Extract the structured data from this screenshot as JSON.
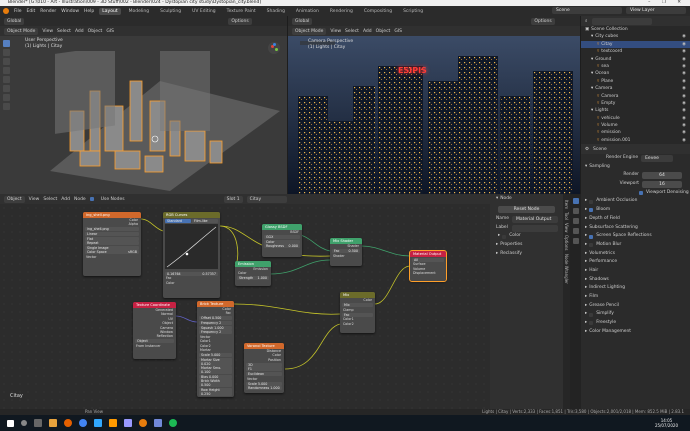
{
  "window": {
    "title": "Blender* [G:\\010 - Art - Illustration\\009 - 3D Stuff\\002 - Blender\\024 - Dystopian city study\\Dystopian_city.blend]",
    "controls": [
      "–",
      "❐",
      "✕"
    ]
  },
  "menu": {
    "items": [
      "File",
      "Edit",
      "Render",
      "Window",
      "Help"
    ],
    "workspaces": [
      "Layout",
      "Modeling",
      "Sculpting",
      "UV Editing",
      "Texture Paint",
      "Shading",
      "Animation",
      "Rendering",
      "Compositing",
      "Scripting"
    ],
    "active_workspace": "Layout",
    "scene_label": "Scene",
    "view_layer_label": "View Layer"
  },
  "viewport_left": {
    "header": {
      "mode": "Object Mode",
      "view": "View",
      "select": "Select",
      "add": "Add",
      "object": "Object",
      "gis": "GIS",
      "orientation": "Global",
      "options": "Options"
    },
    "perspective": "User Perspective",
    "collection": "(1) Lights | Citay"
  },
  "viewport_right": {
    "header": {
      "mode": "Object Mode",
      "view": "View",
      "select": "Select",
      "add": "Add",
      "object": "Object",
      "gis": "GIS",
      "orientation": "Global",
      "options": "Options"
    },
    "perspective": "Camera Perspective",
    "collection": "(1) Lights | Citay",
    "sign_text": "ESIPIS"
  },
  "outliner": {
    "title": "Scene Collection",
    "rows": [
      {
        "label": "City cubes",
        "indent": 1,
        "selected": false
      },
      {
        "label": "Citay",
        "indent": 2,
        "selected": true
      },
      {
        "label": "textcoord",
        "indent": 2,
        "selected": false
      },
      {
        "label": "Ground",
        "indent": 1,
        "selected": false
      },
      {
        "label": "sea",
        "indent": 2,
        "selected": false
      },
      {
        "label": "Ocean",
        "indent": 1,
        "selected": false
      },
      {
        "label": "Plane",
        "indent": 2,
        "selected": false
      },
      {
        "label": "Camera",
        "indent": 1,
        "selected": false
      },
      {
        "label": "Camera",
        "indent": 2,
        "selected": false
      },
      {
        "label": "Empty",
        "indent": 2,
        "selected": false
      },
      {
        "label": "Lights",
        "indent": 1,
        "selected": false
      },
      {
        "label": "vehicule",
        "indent": 2,
        "selected": false
      },
      {
        "label": "Volume",
        "indent": 2,
        "selected": false
      },
      {
        "label": "emission",
        "indent": 2,
        "selected": false
      },
      {
        "label": "emission.001",
        "indent": 2,
        "selected": false
      }
    ]
  },
  "properties": {
    "scene_title": "Scene",
    "render_engine_label": "Render Engine",
    "render_engine": "Eevee",
    "sampling": "Sampling",
    "render_label": "Render",
    "render_samples": "64",
    "viewport_label": "Viewport",
    "viewport_samples": "16",
    "viewport_denoising": "Viewport Denoising",
    "sections": [
      {
        "label": "Ambient Occlusion",
        "checkbox": true,
        "checked": false
      },
      {
        "label": "Bloom",
        "checkbox": true,
        "checked": true
      },
      {
        "label": "Depth of Field",
        "checkbox": false,
        "checked": false
      },
      {
        "label": "Subsurface Scattering",
        "checkbox": false,
        "checked": false
      },
      {
        "label": "Screen Space Reflections",
        "checkbox": true,
        "checked": true
      },
      {
        "label": "Motion Blur",
        "checkbox": true,
        "checked": false
      },
      {
        "label": "Volumetrics",
        "checkbox": false,
        "checked": false
      },
      {
        "label": "Performance",
        "checkbox": false,
        "checked": false
      },
      {
        "label": "Hair",
        "checkbox": false,
        "checked": false
      },
      {
        "label": "Shadows",
        "checkbox": false,
        "checked": false
      },
      {
        "label": "Indirect Lighting",
        "checkbox": false,
        "checked": false
      },
      {
        "label": "Film",
        "checkbox": false,
        "checked": false
      },
      {
        "label": "Grease Pencil",
        "checkbox": false,
        "checked": false
      },
      {
        "label": "Simplify",
        "checkbox": true,
        "checked": false
      },
      {
        "label": "Freestyle",
        "checkbox": true,
        "checked": false
      },
      {
        "label": "Color Management",
        "checkbox": false,
        "checked": false
      }
    ]
  },
  "node_editor": {
    "header": {
      "editor": "Object",
      "view": "View",
      "select": "Select",
      "add": "Add",
      "node": "Node",
      "use_nodes": "Use Nodes",
      "slot": "Slot 1",
      "material": "Citay"
    },
    "footer_label": "Citay",
    "nodes": {
      "image": {
        "title": "ing_shell.png",
        "rows": [
          "Color",
          "Alpha"
        ],
        "fields": [
          "ing_shell.png",
          "Linear",
          "Flat",
          "Repeat",
          "Single Image",
          "Color Space",
          "sRGB",
          "Vector"
        ]
      },
      "rgbcurves": {
        "title": "RGB Curves",
        "tabs": [
          "Standard",
          "Film-like"
        ],
        "fields": [
          "0.16764",
          "0.57357"
        ],
        "rows": [
          "Fac",
          "Color"
        ],
        "fac": "1.000"
      },
      "glossy": {
        "title": "Glossy BSDF",
        "rows": [
          "BSDF",
          "GGX",
          "Color",
          "Roughness",
          "Normal"
        ],
        "roughness": "0.000"
      },
      "emission": {
        "title": "Emission",
        "rows": [
          "Emission",
          "Color",
          "Strength"
        ],
        "strength": "1.000"
      },
      "mixshader": {
        "title": "Mix Shader",
        "rows": [
          "Shader",
          "Fac",
          "Shader",
          "Shader"
        ],
        "fac": "0.500"
      },
      "output": {
        "title": "Material Output",
        "rows": [
          "All",
          "Surface",
          "Volume",
          "Displacement"
        ]
      },
      "texcoord": {
        "title": "Texture Coordinate",
        "rows": [
          "Generated",
          "Normal",
          "UV",
          "Object",
          "Camera",
          "Window",
          "Reflection",
          "Object",
          "From Instancer"
        ]
      },
      "brick": {
        "title": "Brick Texture",
        "rows": [
          "Color",
          "Fac"
        ],
        "fields": [
          "Offset 0.500",
          "Frequency 2",
          "Squash 1.000",
          "Frequency 2"
        ],
        "inputs": [
          "Vector",
          "Color1",
          "Color2",
          "Mortar",
          "Scale 5.000",
          "Mortar Size 0.020",
          "Mortar Smo. 0.100",
          "Bias 0.000",
          "Brick Width 0.500",
          "Row Height 0.250"
        ]
      },
      "voronoi": {
        "title": "Voronoi Texture",
        "rows": [
          "Distance",
          "Color",
          "Position"
        ],
        "fields": [
          "3D",
          "F1",
          "Euclidean",
          "Vector",
          "Scale 5.000",
          "Randomness 1.000"
        ]
      },
      "mixrgb": {
        "title": "Mix",
        "rows": [
          "Color",
          "Mix",
          "Clamp",
          "Fac",
          "Color1",
          "Color2"
        ]
      }
    }
  },
  "node_panel": {
    "tab_node": "Node",
    "reset": "Reset Node",
    "name_label": "Name",
    "name_value": "Material Output",
    "label_label": "Label",
    "color_label": "Color",
    "properties_label": "Properties",
    "reclassify_label": "Reclassify",
    "side_tabs": [
      "Item",
      "Tool",
      "View",
      "Options",
      "Node Wrangler"
    ]
  },
  "status": {
    "left": "Pan View",
    "right": "Lights | Citay | Verts:2,333 | Faces:1,851 | Tris:3,580 | Objects:2,001/2,018 | Mem: 852.5 MiB | 2.83.1"
  },
  "taskbar": {
    "time": "14:05",
    "date": "25/07/2020"
  },
  "colors": {
    "accent": "#4772b3",
    "selection_orange": "#ff9f2a",
    "node_texture": "#d1682b",
    "node_shader": "#3fa16b",
    "node_input": "#c62143",
    "node_output": "#c62143",
    "node_color": "#6b6b2a"
  }
}
